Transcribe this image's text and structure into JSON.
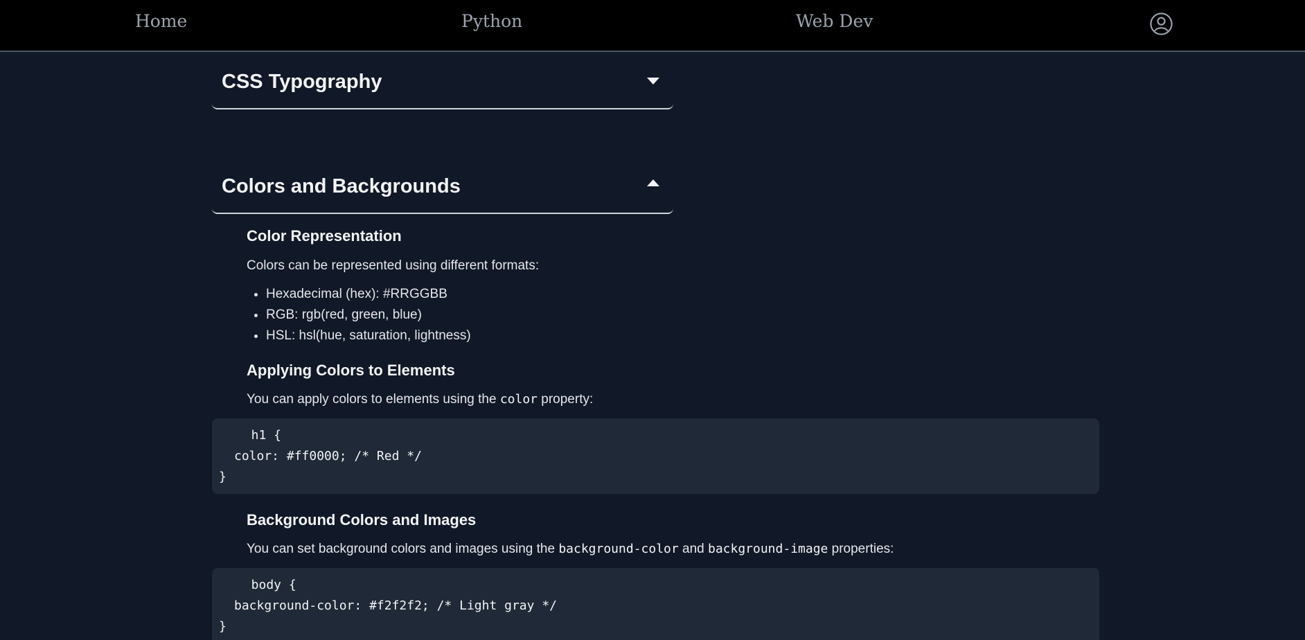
{
  "nav": {
    "home": "Home",
    "python": "Python",
    "webdev": "Web Dev",
    "account_icon": "user-circle-icon"
  },
  "sections": {
    "typography": {
      "title": "CSS Typography",
      "state": "collapsed"
    },
    "colors": {
      "title": "Colors and Backgrounds",
      "state": "expanded"
    }
  },
  "content": {
    "color_rep": {
      "heading": "Color Representation",
      "intro": "Colors can be represented using different formats:",
      "items": [
        "Hexadecimal (hex): #RRGGBB",
        "RGB: rgb(red, green, blue)",
        "HSL: hsl(hue, saturation, lightness)"
      ]
    },
    "applying": {
      "heading": "Applying Colors to Elements",
      "text_before": "You can apply colors to elements using the ",
      "code_word": "color",
      "text_after": " property:",
      "code": [
        "  h1 {",
        "color: #ff0000; /* Red */",
        "}"
      ]
    },
    "background": {
      "heading": "Background Colors and Images",
      "text_before": "You can set background colors and images using the ",
      "code_word_1": "background-color",
      "text_mid": " and ",
      "code_word_2": "background-image",
      "text_after": " properties:",
      "code": [
        "  body {",
        "background-color: #f2f2f2; /* Light gray */",
        "}"
      ]
    }
  },
  "colors": {
    "page_bg": "#111827",
    "nav_bg": "#000000",
    "code_bg": "#1f2937",
    "text": "#e5e7eb"
  }
}
